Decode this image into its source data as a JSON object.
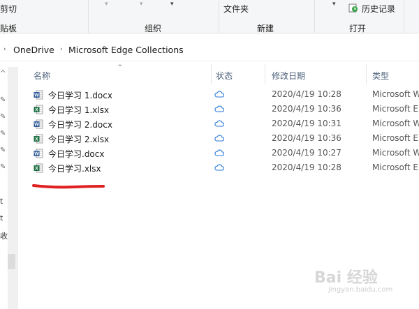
{
  "ribbon": {
    "clipboard_cut": "剪切",
    "clipboard_label": "剪贴板",
    "organize_label": "组织",
    "new_folder": "文件夹",
    "new_label": "新建",
    "history": "历史记录",
    "open_label": "打开",
    "cut_fragment": "剪切",
    "board_fragment": "贴板"
  },
  "address": {
    "crumbs": [
      "OneDrive",
      "Microsoft Edge Collections"
    ]
  },
  "nav": {
    "fragments": [
      "t",
      "t",
      "收"
    ]
  },
  "columns": {
    "name": "名称",
    "status": "状态",
    "date": "修改日期",
    "type": "类型"
  },
  "files": [
    {
      "name": "今日学习 1.docx",
      "date": "2020/4/19 10:28",
      "type": "Microsoft W",
      "kind": "word"
    },
    {
      "name": "今日学习 1.xlsx",
      "date": "2020/4/19 10:36",
      "type": "Microsoft E",
      "kind": "excel"
    },
    {
      "name": "今日学习 2.docx",
      "date": "2020/4/19 10:31",
      "type": "Microsoft W",
      "kind": "word"
    },
    {
      "name": "今日学习 2.xlsx",
      "date": "2020/4/19 10:36",
      "type": "Microsoft E",
      "kind": "excel"
    },
    {
      "name": "今日学习.docx",
      "date": "2020/4/19 10:27",
      "type": "Microsoft W",
      "kind": "word"
    },
    {
      "name": "今日学习.xlsx",
      "date": "2020/4/19 10:28",
      "type": "Microsoft E",
      "kind": "excel"
    }
  ],
  "icons": {
    "word": "word-file-icon",
    "excel": "excel-file-icon",
    "status": "cloud-icon"
  },
  "colors": {
    "word": "#2b5797",
    "excel": "#1e7145",
    "cloud": "#2a7ad8",
    "highlight": "#e02020"
  },
  "watermark": {
    "brand": "Bai 经验",
    "url": "jingyan.baidu.com"
  }
}
